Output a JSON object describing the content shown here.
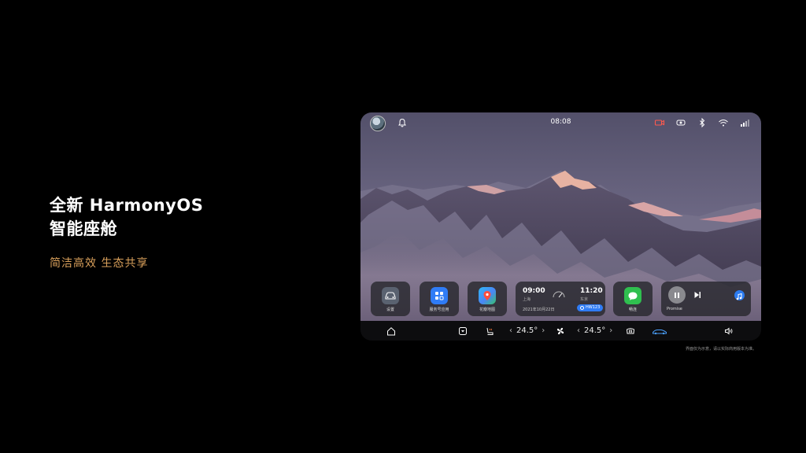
{
  "promo": {
    "title_line1": "全新 HarmonyOS",
    "title_line2": "智能座舱",
    "subtitle": "简洁高效 生态共享"
  },
  "status_bar": {
    "time": "08:08",
    "icons": [
      "bell-icon",
      "camera-icon",
      "hicar-icon",
      "bluetooth-icon",
      "wifi-icon",
      "signal-icon"
    ]
  },
  "apps": [
    {
      "label": "设置",
      "icon": "car-settings-icon",
      "color": "#5a6270"
    },
    {
      "label": "服务号应用",
      "icon": "service-apps-icon",
      "color": "#2f7cf6"
    },
    {
      "label": "花瓣地图",
      "icon": "petal-maps-icon",
      "color": "#2a9df4"
    },
    {
      "label": "畅连",
      "icon": "meetime-chat-icon",
      "color": "#2fbf4f"
    }
  ],
  "clock_widget": {
    "local_time": "09:00",
    "local_city": "上海",
    "remote_time": "11:20",
    "remote_city": "东京",
    "date": "2021年10月22日",
    "badge": "HW123"
  },
  "music_widget": {
    "song": "Promise"
  },
  "dock": {
    "left_temp": "24.5°",
    "right_temp": "24.5°",
    "chevron_left": "‹",
    "chevron_right": "›"
  },
  "disclaimer": "界面仅为示意，请以实际商用版本为准。"
}
